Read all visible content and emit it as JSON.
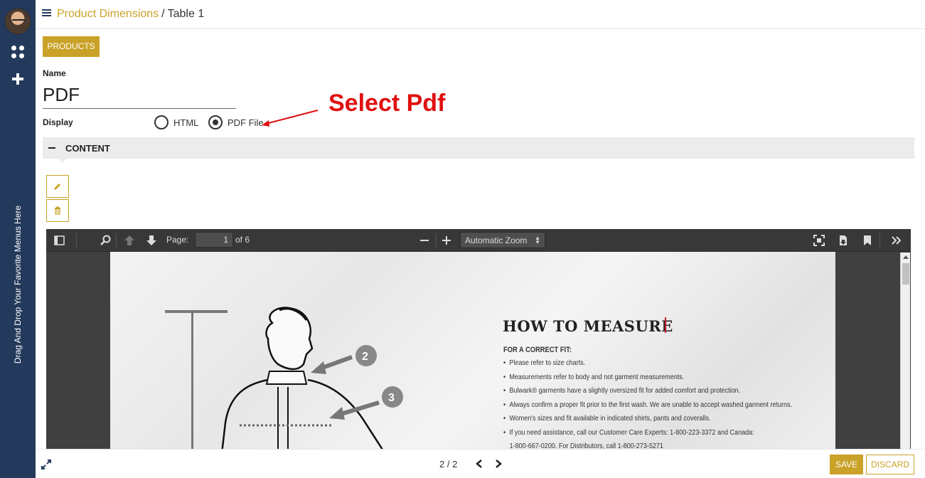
{
  "rail": {
    "favorites_hint": "Drag And Drop Your Favorite Menus Here"
  },
  "breadcrumb": {
    "parent": "Product Dimensions",
    "separator": "/",
    "current": "Table 1"
  },
  "form": {
    "products_button": "PRODUCTS",
    "name_label": "Name",
    "name_value": "PDF",
    "display_label": "Display",
    "display_options": [
      {
        "label": "HTML",
        "selected": false
      },
      {
        "label": "PDF File",
        "selected": true
      }
    ],
    "annotation": "Select Pdf",
    "section_title": "CONTENT"
  },
  "pdf_viewer": {
    "page_label": "Page:",
    "page_current": "1",
    "page_total": "of 6",
    "zoom": "Automatic Zoom",
    "document": {
      "title": "HOW TO MEASURE",
      "subtitle": "FOR A CORRECT FIT:",
      "items": [
        "Please refer to size charts.",
        "Measurements refer to body and not garment measurements.",
        "Bulwark® garments have a slightly oversized fit for added comfort and protection.",
        "Always confirm a proper fit prior to the first wash. We are unable to accept washed garment returns.",
        "Women's sizes and fit available in indicated shirts, pants and coveralls.",
        "If you need assistance, call our Customer Care Experts: 1-800-223-3372 and Canada:",
        "1-800-667-0200. For Distributors, call 1-800-273-5271"
      ],
      "markers": [
        "2",
        "3"
      ]
    }
  },
  "footer": {
    "pager": "2 / 2",
    "save": "SAVE",
    "discard": "DISCARD"
  },
  "colors": {
    "accent": "#c9a227",
    "rail": "#243a5c",
    "annotation": "#e01010"
  }
}
